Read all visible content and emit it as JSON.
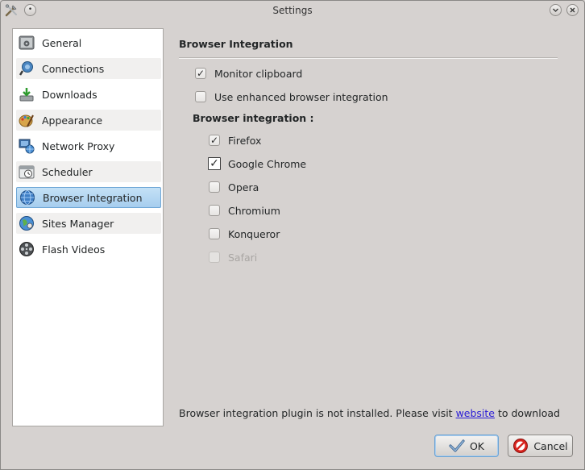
{
  "window": {
    "title": "Settings"
  },
  "sidebar": {
    "items": [
      {
        "label": "General",
        "icon": "general-icon"
      },
      {
        "label": "Connections",
        "icon": "connections-icon"
      },
      {
        "label": "Downloads",
        "icon": "downloads-icon"
      },
      {
        "label": "Appearance",
        "icon": "appearance-icon"
      },
      {
        "label": "Network Proxy",
        "icon": "network-proxy-icon"
      },
      {
        "label": "Scheduler",
        "icon": "scheduler-icon"
      },
      {
        "label": "Browser Integration",
        "icon": "browser-integration-icon",
        "selected": true
      },
      {
        "label": "Sites Manager",
        "icon": "sites-manager-icon"
      },
      {
        "label": "Flash Videos",
        "icon": "flash-videos-icon"
      }
    ]
  },
  "main": {
    "section_title": "Browser Integration",
    "monitor_clipboard": {
      "label": "Monitor clipboard",
      "checked": true
    },
    "enhanced_integration": {
      "label": "Use enhanced browser integration",
      "checked": false
    },
    "browsers_title": "Browser integration :",
    "browsers": [
      {
        "label": "Firefox",
        "checked": true,
        "enabled": true
      },
      {
        "label": "Google Chrome",
        "checked": true,
        "enabled": true,
        "focused": true
      },
      {
        "label": "Opera",
        "checked": false,
        "enabled": true
      },
      {
        "label": "Chromium",
        "checked": false,
        "enabled": true
      },
      {
        "label": "Konqueror",
        "checked": false,
        "enabled": true
      },
      {
        "label": "Safari",
        "checked": false,
        "enabled": false
      }
    ],
    "footer": {
      "before_link": "Browser integration plugin is not installed. Please visit ",
      "link_text": "website",
      "after_link": " to download"
    }
  },
  "buttons": {
    "ok_label": "OK",
    "cancel_label": "Cancel"
  },
  "colors": {
    "selection": "#a6cdee",
    "link": "#2a1cd6",
    "background": "#d6d2d0"
  }
}
